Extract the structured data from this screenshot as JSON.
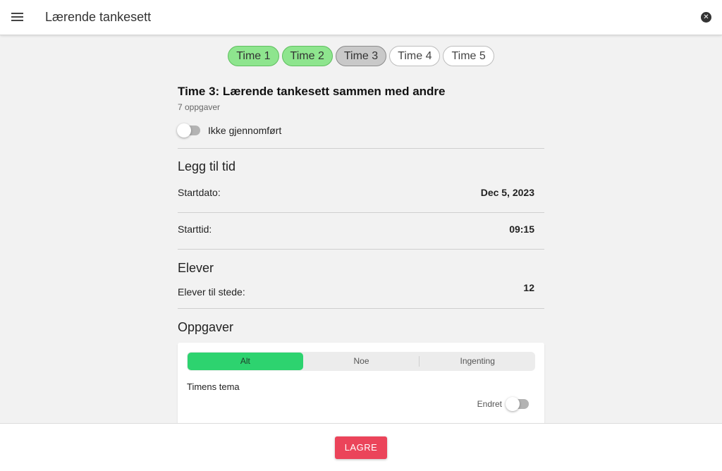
{
  "header": {
    "title": "Lærende tankesett",
    "menu_icon": "menu-icon",
    "close_icon": "close-icon"
  },
  "lesson_tabs": [
    {
      "label": "Time 1",
      "state": "done"
    },
    {
      "label": "Time 2",
      "state": "done"
    },
    {
      "label": "Time 3",
      "state": "active"
    },
    {
      "label": "Time 4",
      "state": "default"
    },
    {
      "label": "Time 5",
      "state": "default"
    }
  ],
  "lesson": {
    "title": "Time 3: Lærende tankesett sammen med andre",
    "task_count": "7 oppgaver",
    "status_label": "Ikke gjennomført",
    "status_on": false
  },
  "time_section": {
    "heading": "Legg til tid",
    "start_date_label": "Startdato:",
    "start_date_value": "Dec 5, 2023",
    "start_time_label": "Starttid:",
    "start_time_value": "09:15"
  },
  "students_section": {
    "heading": "Elever",
    "present_label": "Elever til stede:",
    "present_value": "12"
  },
  "tasks_section": {
    "heading": "Oppgaver",
    "segments": [
      "Alt",
      "Noe",
      "Ingenting"
    ],
    "selected_segment": "Alt",
    "item_label": "Timens tema",
    "changed_label": "Endret",
    "changed_on": false
  },
  "footer": {
    "save_label": "LAGRE"
  },
  "colors": {
    "done_tab": "#8ee58e",
    "active_tab": "#c9c9c9",
    "segment_active": "#2dd36f",
    "save_button": "#eb445a"
  }
}
